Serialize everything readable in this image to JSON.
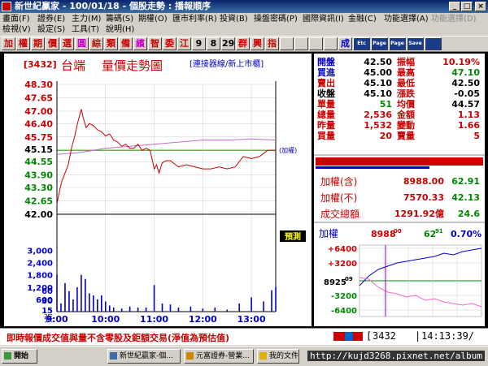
{
  "window": {
    "title": "新世紀贏家 - 100/01/18 - 個股走勢 : 播報順序",
    "min_glyph": "_",
    "max_glyph": "□",
    "close_glyph": "×"
  },
  "menu": {
    "row1": [
      "畫面(F)",
      "證券(E)",
      "主力(M)",
      "籌碼(S)",
      "期權(O)",
      "匯市利率(R)",
      "投資(B)",
      "操盤密碼(P)",
      "國際資訊(I)",
      "金融(C)",
      "功能選擇(A)",
      "功能選擇(D)"
    ],
    "row2": [
      "檢視(V)",
      "設定(S)",
      "工具(T)",
      "說明(H)"
    ]
  },
  "toolbar": [
    "加",
    "權",
    "期",
    "價",
    "選",
    "圓",
    "綜",
    "類",
    "備",
    "繽",
    "智",
    "委",
    "江",
    "9",
    "8",
    "29",
    "群",
    "興",
    "指",
    "",
    "",
    "",
    "",
    "成",
    "Etc",
    "Page",
    "Page",
    "Save",
    ""
  ],
  "chart": {
    "code_label": "[3432]",
    "stock_name": "台端",
    "chart_title": "量價走勢圖",
    "subtitle": "[連接器線/新上市櫃]",
    "index_label": "(加權)",
    "predict_btn": "預測",
    "price_ticks": [
      "48.30",
      "47.65",
      "47.00",
      "46.40",
      "45.75",
      "45.15",
      "44.55",
      "43.90",
      "43.30",
      "42.65",
      "42.00"
    ],
    "vol_ticks": [
      "3,000",
      "2,400",
      "1,800",
      "1,200",
      "600",
      "60",
      "30",
      "15"
    ],
    "vol_unit": "張",
    "time_ticks": [
      "9:00",
      "10:00",
      "11:00",
      "12:00",
      "13:00"
    ]
  },
  "chart_data": {
    "type": "line",
    "title": "量價走勢圖",
    "ylim": [
      42.0,
      48.3
    ],
    "xlim": [
      "9:00",
      "13:30"
    ],
    "reference_price": 45.1,
    "series": [
      {
        "name": "price",
        "x": [
          "9:00",
          "9:03",
          "9:06",
          "9:10",
          "9:14",
          "9:18",
          "9:22",
          "9:26",
          "9:30",
          "9:33",
          "9:36",
          "9:40",
          "9:45",
          "9:50",
          "9:55",
          "10:00",
          "10:05",
          "10:10",
          "10:15",
          "10:20",
          "10:25",
          "10:30",
          "10:35",
          "10:40",
          "10:45",
          "10:50",
          "10:55",
          "11:00",
          "11:03",
          "11:06",
          "11:10",
          "11:15",
          "11:20",
          "11:30",
          "11:40",
          "11:50",
          "12:00",
          "12:10",
          "12:20",
          "12:30",
          "12:40",
          "12:50",
          "13:00",
          "13:10",
          "13:20",
          "13:30"
        ],
        "values": [
          42.5,
          43.1,
          43.6,
          44.0,
          44.4,
          45.2,
          45.8,
          46.5,
          47.1,
          46.6,
          46.2,
          46.4,
          46.3,
          46.1,
          46.0,
          45.8,
          45.9,
          45.6,
          45.5,
          45.3,
          45.4,
          45.2,
          45.2,
          45.4,
          45.1,
          45.2,
          45.1,
          44.2,
          44.4,
          44.0,
          44.5,
          44.6,
          44.6,
          44.3,
          44.4,
          44.3,
          44.2,
          44.2,
          44.3,
          44.2,
          44.3,
          44.8,
          44.7,
          44.8,
          45.1,
          45.1
        ]
      },
      {
        "name": "index",
        "x": [
          "9:00",
          "9:30",
          "10:00",
          "10:30",
          "11:00",
          "11:30",
          "12:00",
          "12:30",
          "13:00",
          "13:30"
        ],
        "values": [
          44.9,
          45.0,
          45.2,
          45.3,
          45.4,
          45.5,
          45.6,
          45.6,
          45.65,
          45.6
        ]
      }
    ],
    "volume": {
      "x": [
        "9:00",
        "9:05",
        "9:10",
        "9:15",
        "9:20",
        "9:25",
        "9:30",
        "9:35",
        "9:40",
        "9:45",
        "9:50",
        "9:55",
        "10:00",
        "10:05",
        "10:10",
        "10:20",
        "10:30",
        "10:40",
        "10:50",
        "11:00",
        "11:10",
        "11:20",
        "11:30",
        "11:45",
        "12:00",
        "12:15",
        "12:30",
        "12:45",
        "13:00",
        "13:15",
        "13:25",
        "13:30"
      ],
      "values": [
        1800,
        400,
        1400,
        1000,
        600,
        1200,
        1800,
        1600,
        900,
        800,
        600,
        800,
        500,
        300,
        200,
        150,
        250,
        200,
        200,
        1300,
        400,
        350,
        200,
        250,
        150,
        200,
        100,
        400,
        700,
        500,
        1050,
        1200
      ]
    }
  },
  "quote": {
    "rows": [
      {
        "l": "開盤",
        "lv": "42.50",
        "r": "振幅",
        "rv": "10.19%",
        "lc": "#0000cc",
        "lvc": "#000",
        "rc": "#cc0000",
        "rvc": "#cc0000"
      },
      {
        "l": "買進",
        "lv": "45.00",
        "r": "最高",
        "rv": "47.10",
        "lc": "#0000cc",
        "lvc": "#000",
        "rc": "#cc0000",
        "rvc": "#008800"
      },
      {
        "l": "賣出",
        "lv": "45.10",
        "r": "最低",
        "rv": "42.50",
        "lc": "#cc0000",
        "lvc": "#000",
        "rc": "#cc0000",
        "rvc": "#000"
      },
      {
        "l": "收盤",
        "lv": "45.10",
        "r": "漲跌",
        "rv": "-0.05",
        "lc": "#000",
        "lvc": "#000",
        "rc": "#cc0000",
        "rvc": "#000"
      },
      {
        "l": "單量",
        "lv": "51",
        "r": "均價",
        "rv": "44.57",
        "lc": "#cc0000",
        "lvc": "#008800",
        "rc": "#cc0000",
        "rvc": "#000"
      },
      {
        "l": "總量",
        "lv": "2,536",
        "r": "金額",
        "rv": "1.13",
        "lc": "#cc0000",
        "lvc": "#cc0000",
        "rc": "#cc0000",
        "rvc": "#cc0000"
      },
      {
        "l": "昨量",
        "lv": "1,532",
        "r": "變動",
        "rv": "1.66",
        "lc": "#cc0000",
        "lvc": "#cc0000",
        "rc": "#cc0000",
        "rvc": "#cc0000"
      },
      {
        "l": "買量",
        "lv": "20",
        "r": "賣量",
        "rv": "5",
        "lc": "#cc0000",
        "lvc": "#cc0000",
        "rc": "#cc0000",
        "rvc": "#cc0000"
      }
    ],
    "index_rows": [
      {
        "l": "加權(含)",
        "v": "8988.00",
        "c": "62.91"
      },
      {
        "l": "加權(不)",
        "v": "7570.33",
        "c": "42.13"
      },
      {
        "l": "成交總額",
        "v": "1291.92億",
        "c": "24.6"
      }
    ]
  },
  "mini": {
    "label": "加權",
    "value": "8988",
    "value_sup": "00",
    "change": "62",
    "change_sup": "91",
    "pct": "0.70%",
    "center": "8925",
    "center_sup": "09",
    "ticks": [
      "+6400",
      "+3200",
      "-3200",
      "-6400"
    ]
  },
  "status": {
    "notice": "即時報價成交值與量不含零股及鉅額交易(淨值為預估值)",
    "code": "3432",
    "clock": "14:13:39/"
  },
  "taskbar": {
    "start": "開始",
    "tasks": [
      "新世紀贏家-個...",
      "元富證券-營業...",
      "我的文件"
    ],
    "watermark": "http://kujd3268.pixnet.net/album"
  },
  "colors": {
    "up": "#cc0000",
    "down": "#008800",
    "accent": "#0000cc",
    "grid": "#00aa00"
  }
}
